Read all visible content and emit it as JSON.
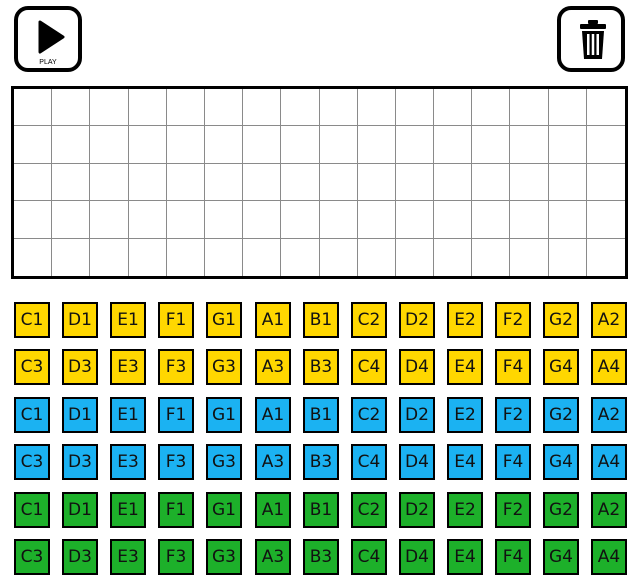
{
  "toolbar": {
    "play_label": "PLAY",
    "play_icon": "play-icon",
    "trash_icon": "trash-icon"
  },
  "sequencer": {
    "columns": 16,
    "rows": 5
  },
  "note_palettes": [
    {
      "color": "#FFD700",
      "rows": [
        [
          "C1",
          "D1",
          "E1",
          "F1",
          "G1",
          "A1",
          "B1",
          "C2",
          "D2",
          "E2",
          "F2",
          "G2",
          "A2"
        ],
        [
          "C3",
          "D3",
          "E3",
          "F3",
          "G3",
          "A3",
          "B3",
          "C4",
          "D4",
          "E4",
          "F4",
          "G4",
          "A4"
        ]
      ]
    },
    {
      "color": "#1BB2F2",
      "rows": [
        [
          "C1",
          "D1",
          "E1",
          "F1",
          "G1",
          "A1",
          "B1",
          "C2",
          "D2",
          "E2",
          "F2",
          "G2",
          "A2"
        ],
        [
          "C3",
          "D3",
          "E3",
          "F3",
          "G3",
          "A3",
          "B3",
          "C4",
          "D4",
          "E4",
          "F4",
          "G4",
          "A4"
        ]
      ]
    },
    {
      "color": "#1DB02A",
      "rows": [
        [
          "C1",
          "D1",
          "E1",
          "F1",
          "G1",
          "A1",
          "B1",
          "C2",
          "D2",
          "E2",
          "F2",
          "G2",
          "A2"
        ],
        [
          "C3",
          "D3",
          "E3",
          "F3",
          "G3",
          "A3",
          "B3",
          "C4",
          "D4",
          "E4",
          "F4",
          "G4",
          "A4"
        ]
      ]
    }
  ]
}
